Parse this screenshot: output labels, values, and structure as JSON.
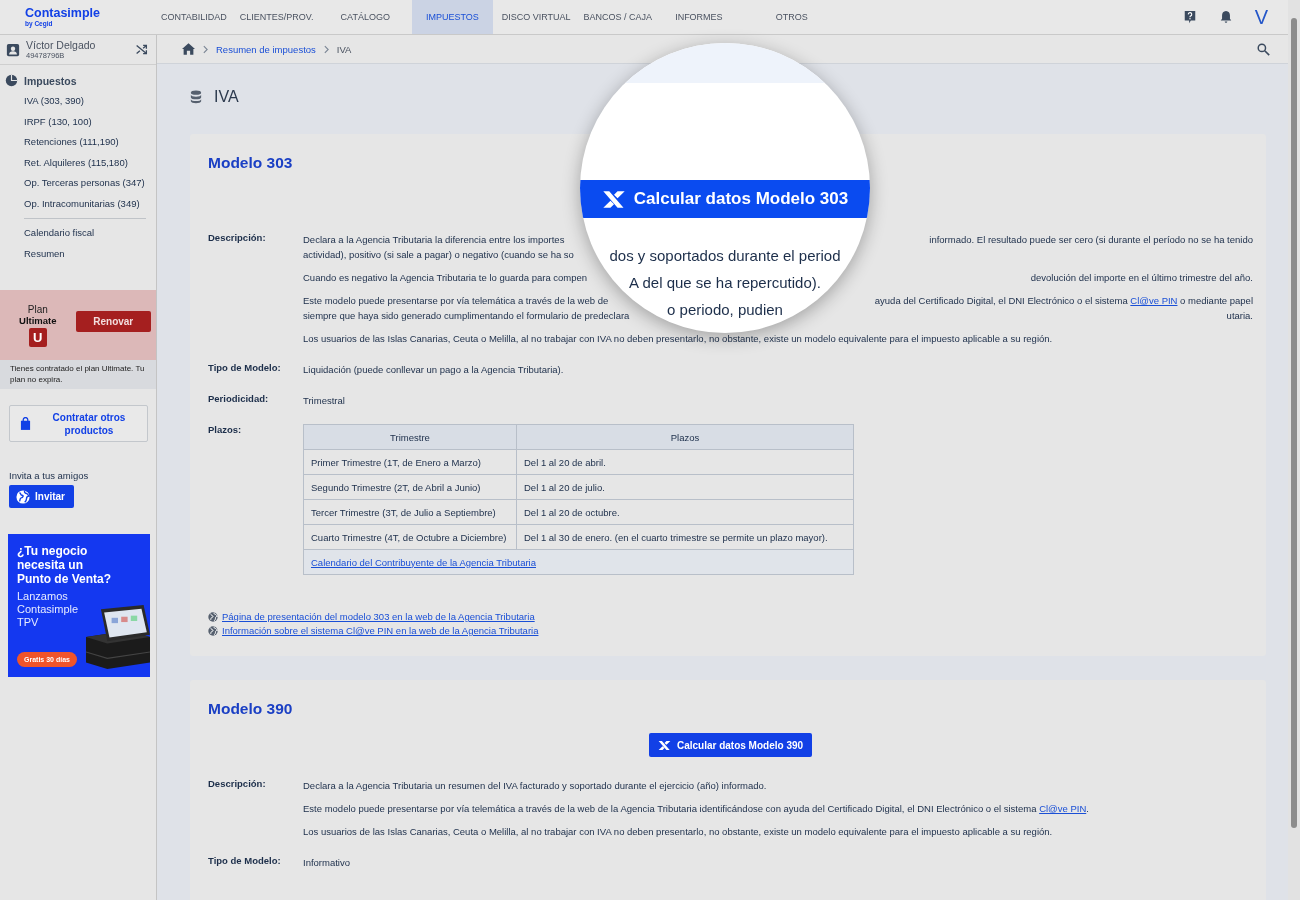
{
  "brand": {
    "name": "Contasimple",
    "tagline": "by Cegid"
  },
  "nav": [
    {
      "label": "CONTABILIDAD",
      "selected": false
    },
    {
      "label": "CLIENTES/PROV.",
      "selected": false
    },
    {
      "label": "CATÁLOGO",
      "selected": false
    },
    {
      "label": "IMPUESTOS",
      "selected": true
    },
    {
      "label": "DISCO VIRTUAL",
      "selected": false
    },
    {
      "label": "BANCOS / CAJA",
      "selected": false
    },
    {
      "label": "INFORMES",
      "selected": false
    },
    {
      "label": "OTROS",
      "selected": false
    }
  ],
  "avatar": "V",
  "user": {
    "name": "Víctor Delgado",
    "id": "49478796B"
  },
  "breadcrumb": [
    {
      "label": "Resumen de impuestos",
      "current": false
    },
    {
      "label": "IVA",
      "current": true
    }
  ],
  "sidebar": {
    "section": "Impuestos",
    "items": [
      "IVA (303, 390)",
      "IRPF (130, 100)",
      "Retenciones (111,190)",
      "Ret. Alquileres (115,180)",
      "Op. Terceras personas (347)",
      "Op. Intracomunitarias (349)"
    ],
    "extra_items": [
      "Calendario fiscal",
      "Resumen"
    ]
  },
  "plan": {
    "label": "Plan",
    "name": "Ultimate",
    "badge": "U",
    "renew": "Renovar",
    "note": "Tienes contratado el plan Ultimate. Tu plan no expira."
  },
  "shop_button": "Contratar otros productos",
  "invite": {
    "label": "Invita a tus amigos",
    "button": "Invitar"
  },
  "banner": {
    "headline": "¿Tu negocio necesita un Punto de Venta?",
    "body": "Lanzamos Contasimple TPV",
    "cta": "Gratis 30 días"
  },
  "page_title": "IVA",
  "models": [
    {
      "title": "Modelo 303",
      "fields": [
        {
          "label": "Descripción:",
          "kind": "paragraphs",
          "paragraphs": [
            {
              "lines": [
                {
                  "left": [
                    {
                      "kind": "text",
                      "text": "Declara a la Agencia Tributaria la diferencia entre los importes"
                    }
                  ],
                  "right": [
                    {
                      "kind": "text",
                      "text": "informado. El resultado puede ser cero (si durante el período no se ha tenido"
                    }
                  ]
                },
                {
                  "left": [
                    {
                      "kind": "text",
                      "text": "actividad), positivo (si sale a pagar) o negativo (cuando se ha so"
                    }
                  ]
                }
              ]
            },
            {
              "lines": [
                {
                  "left": [
                    {
                      "kind": "text",
                      "text": "Cuando es negativo la Agencia Tributaria te lo guarda para compen"
                    }
                  ],
                  "right": [
                    {
                      "kind": "text",
                      "text": "devolución del importe en el último trimestre del año."
                    }
                  ]
                }
              ]
            },
            {
              "lines": [
                {
                  "left": [
                    {
                      "kind": "text",
                      "text": "Este modelo puede presentarse por vía telemática a través de la web de"
                    }
                  ],
                  "right": [
                    {
                      "kind": "text",
                      "text": "ayuda del Certificado Digital, el DNI Electrónico o el sistema "
                    },
                    {
                      "kind": "link",
                      "text": "Cl@ve PIN"
                    },
                    {
                      "kind": "text",
                      "text": " o mediante papel"
                    }
                  ]
                },
                {
                  "left": [
                    {
                      "kind": "text",
                      "text": "siempre que haya sido generado cumplimentando el formulario de predeclara"
                    }
                  ],
                  "right": [
                    {
                      "kind": "text",
                      "text": "utaria."
                    }
                  ]
                }
              ]
            },
            {
              "lines": [
                {
                  "left": [
                    {
                      "kind": "text",
                      "text": "Los usuarios de las Islas Canarias, Ceuta o Melilla, al no trabajar con IVA no deben presentarlo, no obstante, existe un modelo equivalente para el impuesto aplicable a su región."
                    }
                  ]
                }
              ]
            }
          ]
        },
        {
          "label": "Tipo de Modelo:",
          "kind": "text",
          "value": "Liquidación (puede conllevar un pago a la Agencia Tributaria)."
        },
        {
          "label": "Periodicidad:",
          "kind": "text",
          "value": "Trimestral"
        },
        {
          "label": "Plazos:",
          "kind": "table",
          "columns": [
            "Trimestre",
            "Plazos"
          ],
          "rows": [
            [
              "Primer Trimestre (1T, de Enero a Marzo)",
              "Del 1 al 20 de abril."
            ],
            [
              "Segundo Trimestre (2T, de Abril a Junio)",
              "Del 1 al 20 de julio."
            ],
            [
              "Tercer Trimestre (3T, de Julio a Septiembre)",
              "Del 1 al 20 de octubre."
            ],
            [
              "Cuarto Trimestre (4T, de Octubre a Diciembre)",
              "Del 1 al 30 de enero. (en el cuarto trimestre se permite un plazo mayor)."
            ]
          ],
          "footer_link": "Calendario del Contribuyente de la Agencia Tributaria"
        }
      ],
      "links": [
        "Página de presentación del modelo 303 en la web de la Agencia Tributaria",
        "Información sobre el sistema Cl@ve PIN en la web de la Agencia Tributaria"
      ]
    },
    {
      "title": "Modelo 390",
      "button": "Calcular datos Modelo 390",
      "fields": [
        {
          "label": "Descripción:",
          "kind": "paragraphs",
          "paragraphs": [
            {
              "lines": [
                {
                  "left": [
                    {
                      "kind": "text",
                      "text": "Declara a la Agencia Tributaria un resumen del IVA facturado y soportado durante el ejercicio (año) informado."
                    }
                  ]
                }
              ]
            },
            {
              "lines": [
                {
                  "left": [
                    {
                      "kind": "text",
                      "text": "Este modelo puede presentarse por vía telemática a través de la web de la Agencia Tributaria identificándose con ayuda del Certificado Digital, el DNI Electrónico o el sistema "
                    },
                    {
                      "kind": "link",
                      "text": "Cl@ve PIN"
                    },
                    {
                      "kind": "text",
                      "text": "."
                    }
                  ]
                }
              ]
            },
            {
              "lines": [
                {
                  "left": [
                    {
                      "kind": "text",
                      "text": "Los usuarios de las Islas Canarias, Ceuta o Melilla, al no trabajar con IVA no deben presentarlo, no obstante, existe un modelo equivalente para el impuesto aplicable a su región."
                    }
                  ]
                }
              ]
            }
          ]
        },
        {
          "label": "Tipo de Modelo:",
          "kind": "text",
          "value": "Informativo"
        }
      ]
    }
  ],
  "magnifier": {
    "button": "Calcular datos Modelo 303",
    "lines": [
      "dos y soportados durante el period",
      "A del que se ha repercutido).",
      "o periodo, pudien"
    ]
  }
}
